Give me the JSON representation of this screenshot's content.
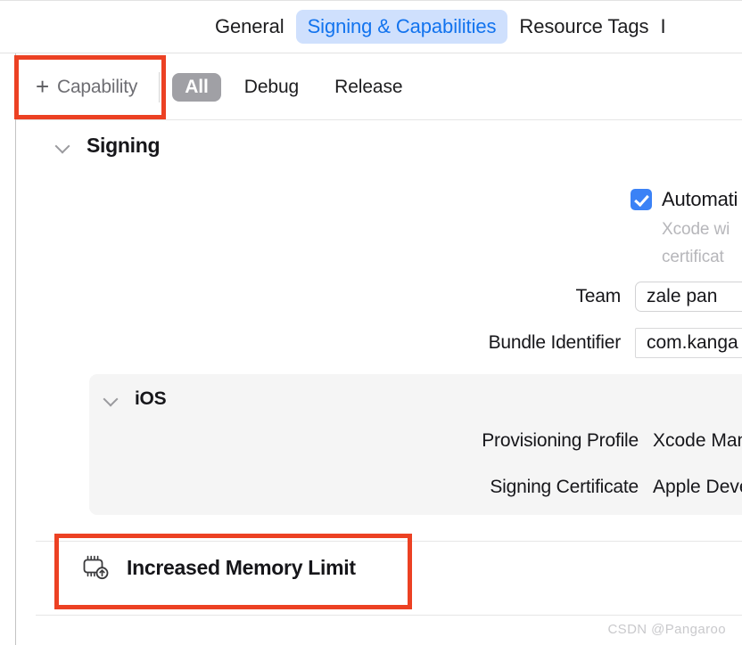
{
  "tabbar": {
    "tabs": [
      {
        "label": "General",
        "active": false
      },
      {
        "label": "Signing & Capabilities",
        "active": true
      },
      {
        "label": "Resource Tags",
        "active": false
      }
    ],
    "partial_tab": "I",
    "active_color": "#1273ee",
    "active_bg": "#cfe0fd"
  },
  "toolbar": {
    "add_capability_label": "Capability",
    "plus_glyph": "+",
    "segments": [
      {
        "label": "All",
        "selected": true
      },
      {
        "label": "Debug",
        "selected": false
      },
      {
        "label": "Release",
        "selected": false
      }
    ],
    "selected_bg": "#a0a0a5"
  },
  "signing": {
    "title": "Signing",
    "automatic": {
      "checked": true,
      "checkbox_color": "#3b82f6",
      "label": "Automati",
      "description_line1": "Xcode wi",
      "description_line2": "certificat"
    },
    "fields": [
      {
        "label": "Team",
        "value": "zale pan",
        "type": "popup"
      },
      {
        "label": "Bundle Identifier",
        "value": "com.kanga",
        "type": "textfield"
      }
    ]
  },
  "ios_panel": {
    "title": "iOS",
    "background": "#f5f5f5",
    "fields": [
      {
        "label": "Provisioning Profile",
        "value": "Xcode Mana"
      },
      {
        "label": "Signing Certificate",
        "value": "Apple Deve"
      }
    ]
  },
  "capability": {
    "name": "Increased Memory Limit",
    "icon": "memory-chip-icon"
  },
  "annotations": {
    "color": "#ec4123",
    "boxes": [
      {
        "target": "add-capability-button"
      },
      {
        "target": "increased-memory-limit-row"
      }
    ]
  },
  "watermark": {
    "text": "CSDN @Pangaroo"
  }
}
